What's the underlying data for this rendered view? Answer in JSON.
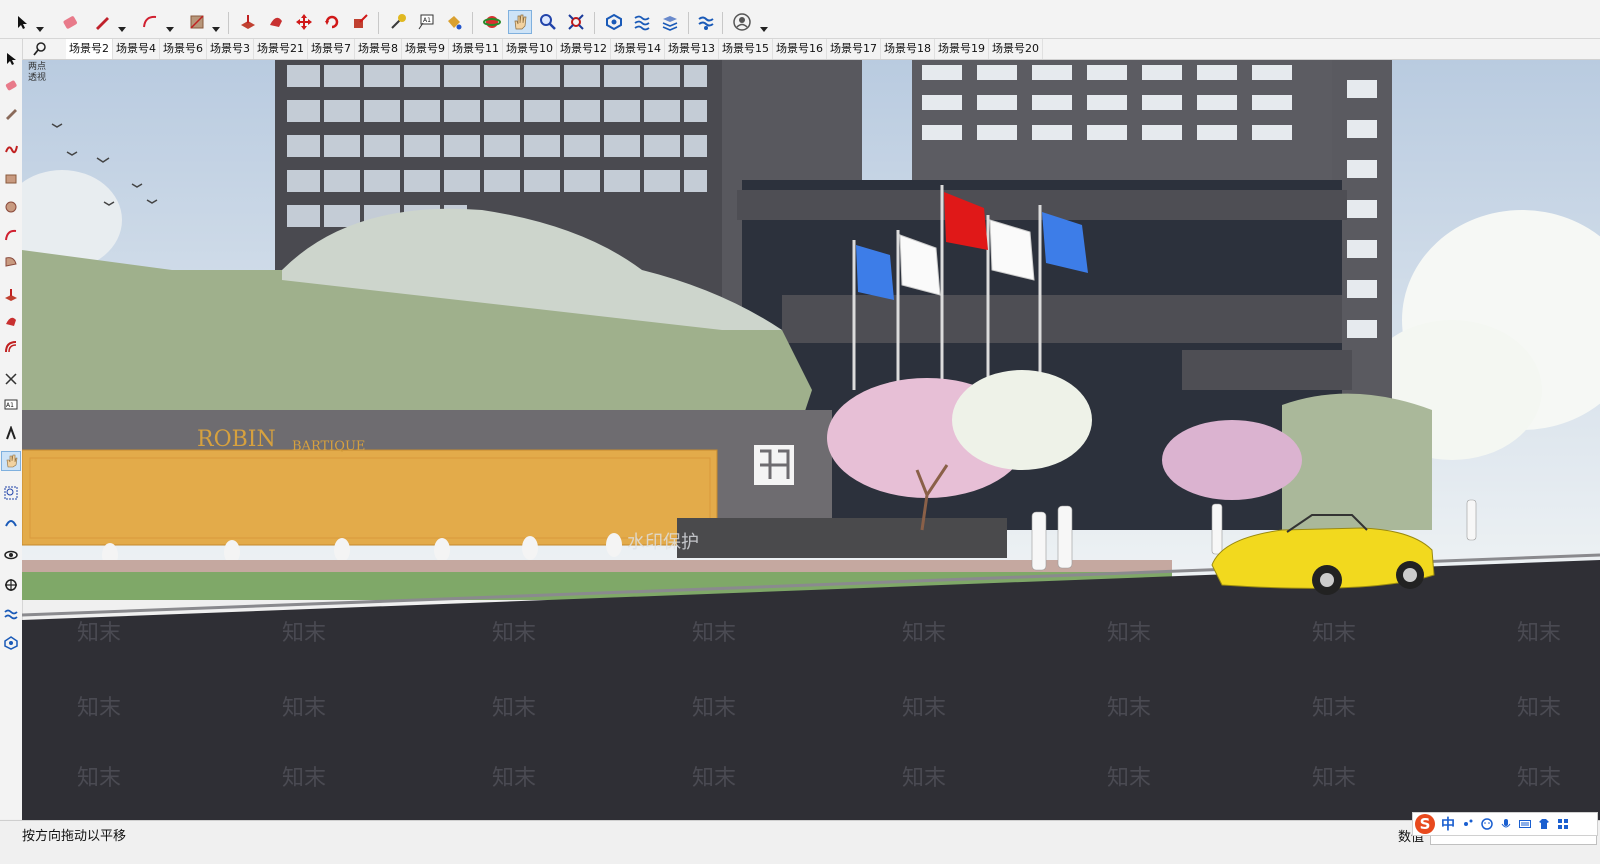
{
  "toolbar": {
    "tools": [
      "select-tool",
      "eraser-tool",
      "pencil-line-tool",
      "arc-tool",
      "shape-tool",
      "push-pull-tool",
      "follow-me-tool",
      "move-tool",
      "rotate-tool",
      "scale-tool",
      "tape-measure-tool",
      "text-tool",
      "paint-bucket-tool",
      "orbit-tool",
      "pan-tool",
      "zoom-tool",
      "zoom-extents-tool",
      "sandbox-tool",
      "terrain-tool",
      "layer-tool",
      "styles-tool",
      "account-icon"
    ]
  },
  "scenes": {
    "tabs": [
      "场景号2",
      "场景号4",
      "场景号6",
      "场景号3",
      "场景号21",
      "场景号7",
      "场景号8",
      "场景号9",
      "场景号11",
      "场景号10",
      "场景号12",
      "场景号14",
      "场景号13",
      "场景号15",
      "场景号16",
      "场景号17",
      "场景号18",
      "场景号19",
      "场景号20"
    ],
    "active_index": 0
  },
  "viewport": {
    "corner_label": [
      "两点",
      "透视"
    ],
    "sign_brand": "ROBIN",
    "sign_sub": "BARTIQUE",
    "watermark": "知末",
    "overlay_text": "水印保护"
  },
  "status": {
    "hint": "按方向拖动以平移",
    "measure_label": "数值"
  },
  "ime": {
    "zh_label": "中"
  },
  "colors": {
    "accent": "#cde3f7",
    "wall_orange": "#e3ab4a",
    "sky": "#dce7f0",
    "road": "#2f2f35",
    "flag_red": "#e01818",
    "flag_blue": "#3d7de8",
    "car_yellow": "#f2d91e"
  }
}
